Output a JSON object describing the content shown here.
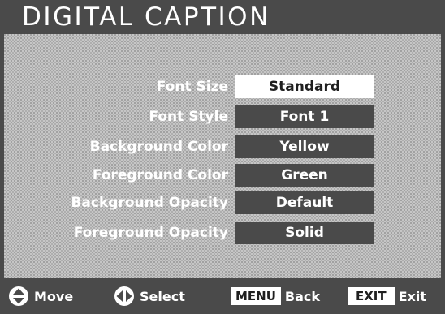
{
  "header": {
    "title": "DIGITAL CAPTION"
  },
  "menu": {
    "items": [
      {
        "label": "Font Size",
        "value": "Standard",
        "selected": true
      },
      {
        "label": "Font Style",
        "value": "Font 1",
        "selected": false
      },
      {
        "label": "Background Color",
        "value": "Yellow",
        "selected": false
      },
      {
        "label": "Foreground Color",
        "value": "Green",
        "selected": false
      },
      {
        "label": "Background Opacity",
        "value": "Default",
        "selected": false
      },
      {
        "label": "Foreground Opacity",
        "value": "Solid",
        "selected": false
      }
    ]
  },
  "footer": {
    "move_label": "Move",
    "move_icon": "up-down-arrows-icon",
    "select_label": "Select",
    "select_icon": "left-right-arrows-icon",
    "menu_key": "MENU",
    "menu_label": "Back",
    "exit_key": "EXIT",
    "exit_label": "Exit"
  },
  "colors": {
    "frame": "#4a4a4a",
    "panel": "#c6c6c6",
    "highlight": "#ffffff",
    "text": "#ffffff"
  }
}
